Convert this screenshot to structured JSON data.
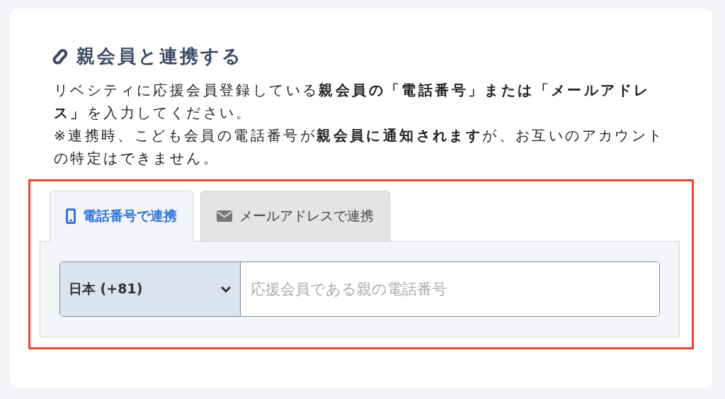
{
  "section": {
    "title": "親会員と連携する",
    "paragraphs": [
      "リベシティに応援会員登録している**親会員の「電話番号」または「メールアドレス」**を入力してください。",
      "※連携時、こども会員の電話番号が**親会員に通知されます**が、お互いのアカウントの特定はできません。"
    ]
  },
  "tabs": [
    {
      "label": "電話番号で連携",
      "kind": "phone",
      "selected": true
    },
    {
      "label": "メールアドレスで連携",
      "kind": "mail",
      "selected": false
    }
  ],
  "phone_form": {
    "country": "日本 (+81)",
    "placeholder": "応援会員である親の電話番号"
  }
}
